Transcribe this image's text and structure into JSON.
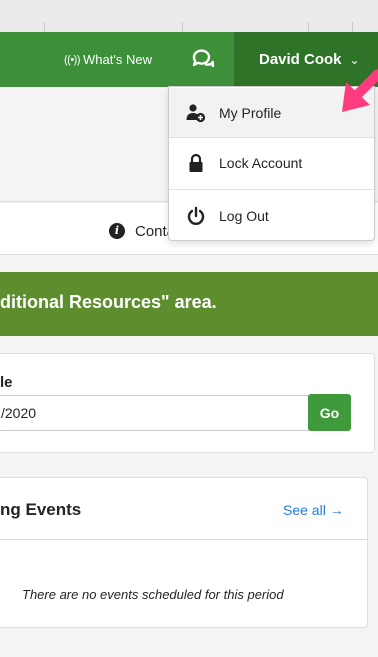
{
  "navbar": {
    "whats_new_label": "What's New",
    "whats_new_icon": "broadcast-icon",
    "chat_icon": "chat-bubbles-icon",
    "user_name": "David Cook",
    "colors": {
      "navbar": "#3e8f3a",
      "user_button": "#2e7328"
    }
  },
  "dropdown": {
    "items": [
      {
        "label": "My Profile",
        "icon": "user-plus-icon"
      },
      {
        "label": "Lock Account",
        "icon": "lock-icon"
      },
      {
        "label": "Log Out",
        "icon": "power-icon"
      }
    ]
  },
  "contact": {
    "label": "Conta"
  },
  "banner": {
    "text": "ditional Resources\" area.",
    "color": "#5d8d2d"
  },
  "date_selector": {
    "label": "le",
    "value": "/2020",
    "go_label": "Go"
  },
  "events": {
    "title": "ng Events",
    "see_all": "See all →",
    "empty_message": "There are no events scheduled for this period"
  },
  "annotation": {
    "arrow_color": "#ff3b7f"
  }
}
